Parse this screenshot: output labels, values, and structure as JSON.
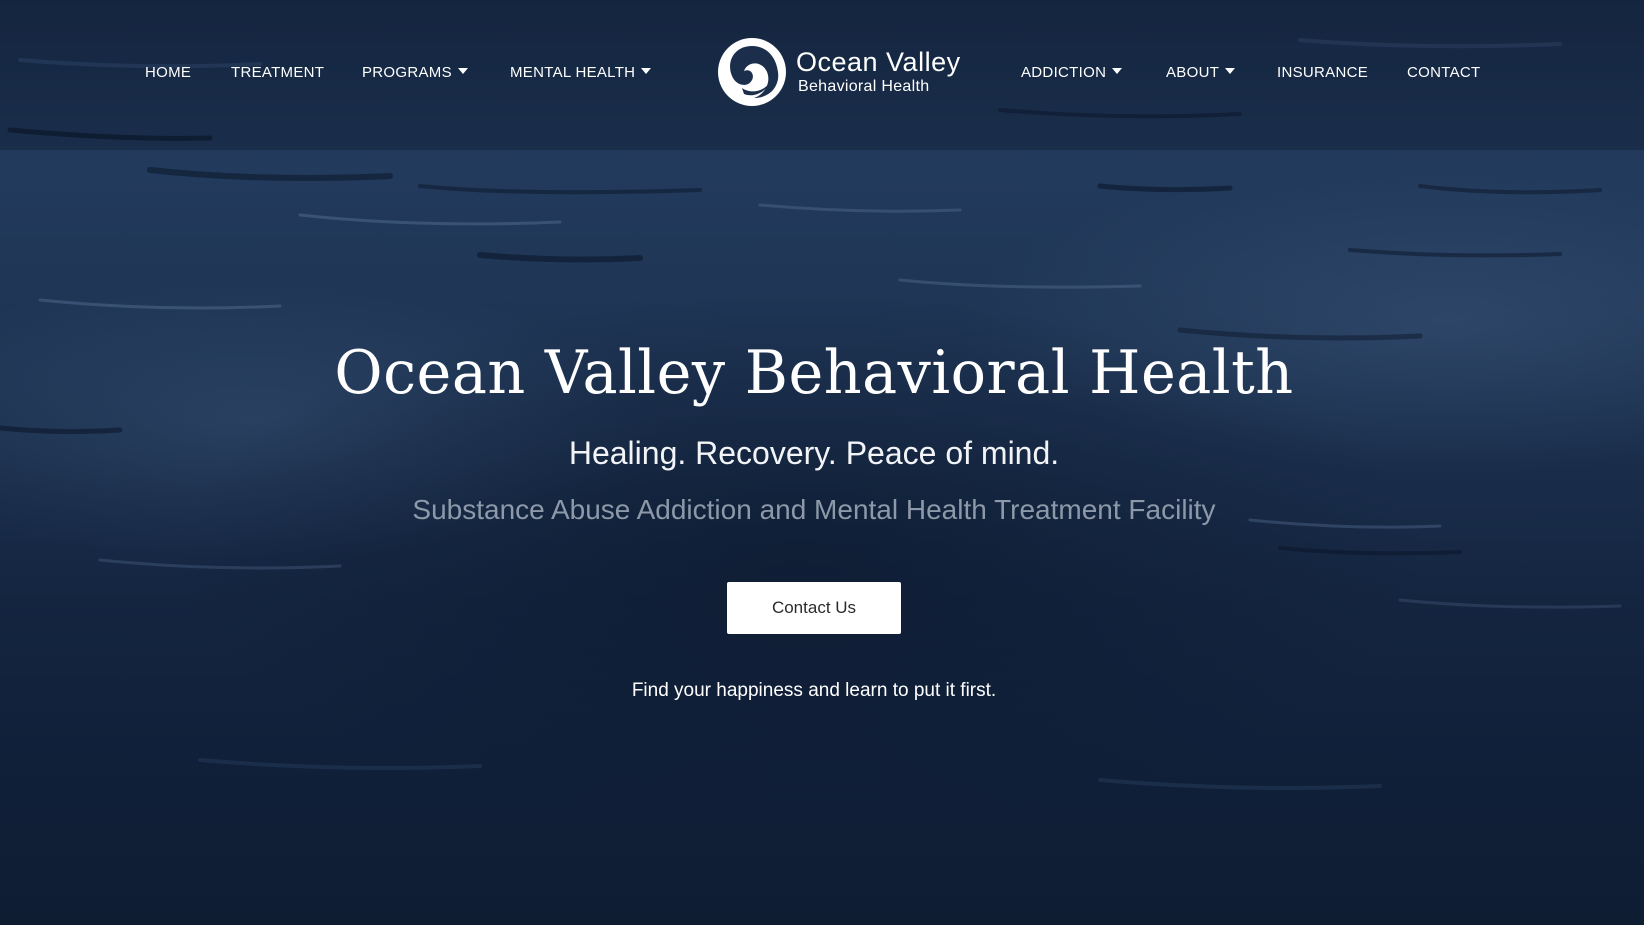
{
  "nav": {
    "left_items": [
      {
        "label": "HOME"
      },
      {
        "label": "TREATMENT"
      },
      {
        "label": "PROGRAMS"
      },
      {
        "label": "MENTAL HEALTH"
      }
    ],
    "right_items": [
      {
        "label": "ADDICTION"
      },
      {
        "label": "ABOUT"
      },
      {
        "label": "INSURANCE"
      },
      {
        "label": "CONTACT"
      }
    ]
  },
  "logo": {
    "name": "Ocean Valley",
    "subtitle": "Behavioral Health"
  },
  "hero": {
    "title": "Ocean Valley Behavioral Health",
    "tagline": "Healing. Recovery. Peace of mind.",
    "subtitle": "Substance Abuse Addiction and Mental Health Treatment Facility",
    "cta_label": "Contact Us",
    "footer_text": "Find your happiness and learn to put it first."
  },
  "colors": {
    "background": "#1d3352",
    "text": "#ffffff",
    "subtitle_text": "#8d98a8",
    "button_bg": "#ffffff",
    "button_text": "#2b2b2b"
  }
}
